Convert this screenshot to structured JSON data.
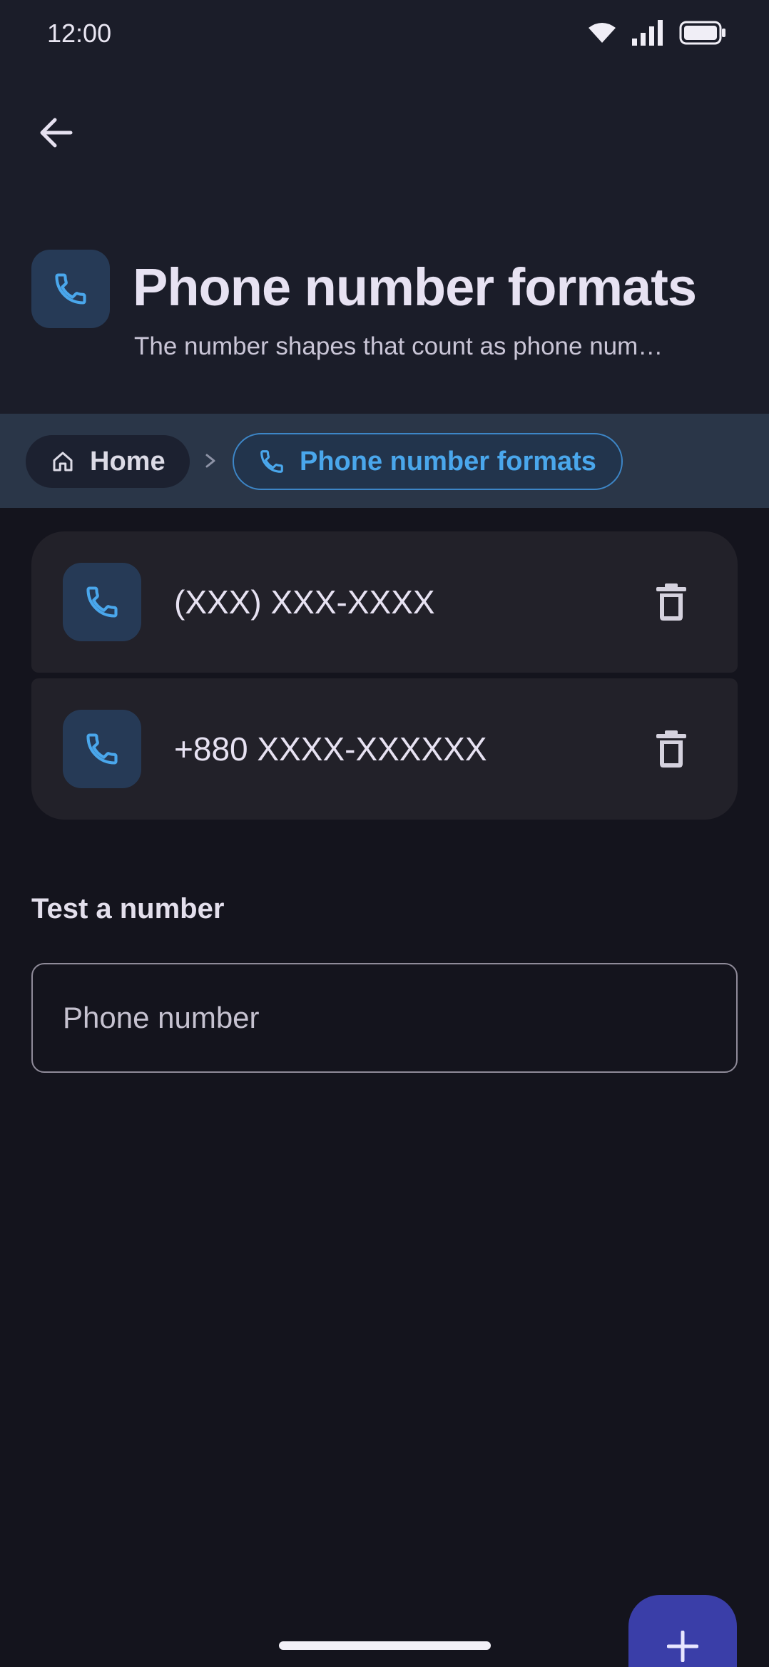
{
  "status_bar": {
    "time": "12:00"
  },
  "header": {
    "title": "Phone number formats",
    "subtitle": "The number shapes that count as phone num…"
  },
  "breadcrumb": {
    "home_label": "Home",
    "current_label": "Phone number formats"
  },
  "formats": [
    {
      "pattern": "(XXX) XXX-XXXX"
    },
    {
      "pattern": "+880 XXXX-XXXXXX"
    }
  ],
  "test": {
    "section_label": "Test a number",
    "input_placeholder": "Phone number",
    "input_value": ""
  },
  "colors": {
    "accent": "#4aa7ec",
    "fab": "#3a3ea8",
    "icon_box": "#263a56"
  },
  "icons": {
    "back": "arrow-back-icon",
    "phone": "phone-icon",
    "home": "home-icon",
    "delete": "trash-icon",
    "add": "plus-icon"
  }
}
